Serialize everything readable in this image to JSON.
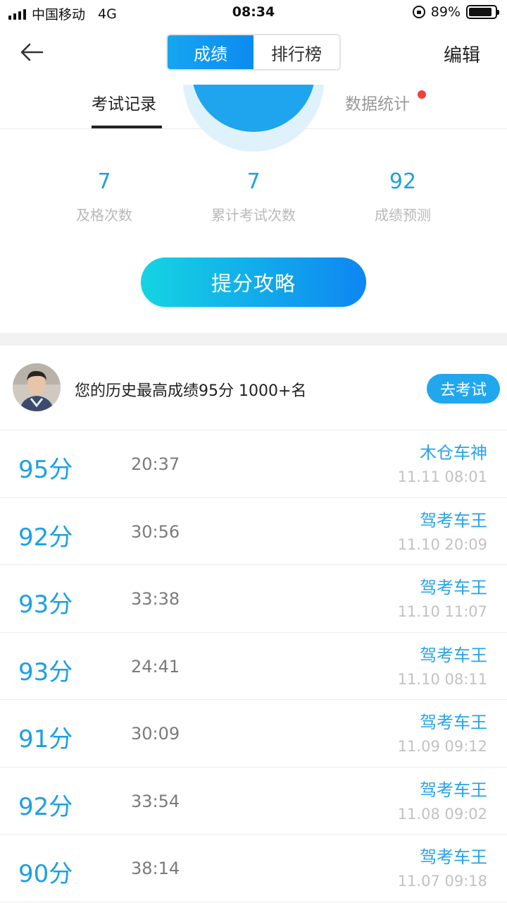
{
  "status_bar": {
    "carrier": "中国移动",
    "network": "4G",
    "time": "08:34",
    "battery": "89%",
    "battery_level": 0.89
  },
  "nav": {
    "segments": [
      "成绩",
      "排行榜"
    ],
    "active_segment": "成绩",
    "edit_label": "编辑"
  },
  "tabs": {
    "items": [
      "考试记录",
      "数据统计"
    ],
    "active": "考试记录"
  },
  "stats": [
    {
      "value": "7",
      "label": "及格次数"
    },
    {
      "value": "7",
      "label": "累计考试次数"
    },
    {
      "value": "92",
      "label": "成绩预测"
    }
  ],
  "tips_button": "提分攻略",
  "best": {
    "text": "您的历史最高成绩95分  1000+名",
    "button": "去考试"
  },
  "records": [
    {
      "score": "95分",
      "duration": "20:37",
      "title": "木仓车神",
      "date": "11.11 08:01"
    },
    {
      "score": "92分",
      "duration": "30:56",
      "title": "驾考车王",
      "date": "11.10 20:09"
    },
    {
      "score": "93分",
      "duration": "33:38",
      "title": "驾考车王",
      "date": "11.10 11:07"
    },
    {
      "score": "93分",
      "duration": "24:41",
      "title": "驾考车王",
      "date": "11.10 08:11"
    },
    {
      "score": "91分",
      "duration": "30:09",
      "title": "驾考车王",
      "date": "11.09 09:12"
    },
    {
      "score": "92分",
      "duration": "33:54",
      "title": "驾考车王",
      "date": "11.08 09:02"
    },
    {
      "score": "90分",
      "duration": "38:14",
      "title": "驾考车王",
      "date": "11.07 09:18"
    }
  ],
  "colors": {
    "accent": "#1ea2e6",
    "button_gradient_start": "#15d4e2",
    "button_gradient_end": "#0e86f2",
    "badge_red": "#f2413a"
  }
}
